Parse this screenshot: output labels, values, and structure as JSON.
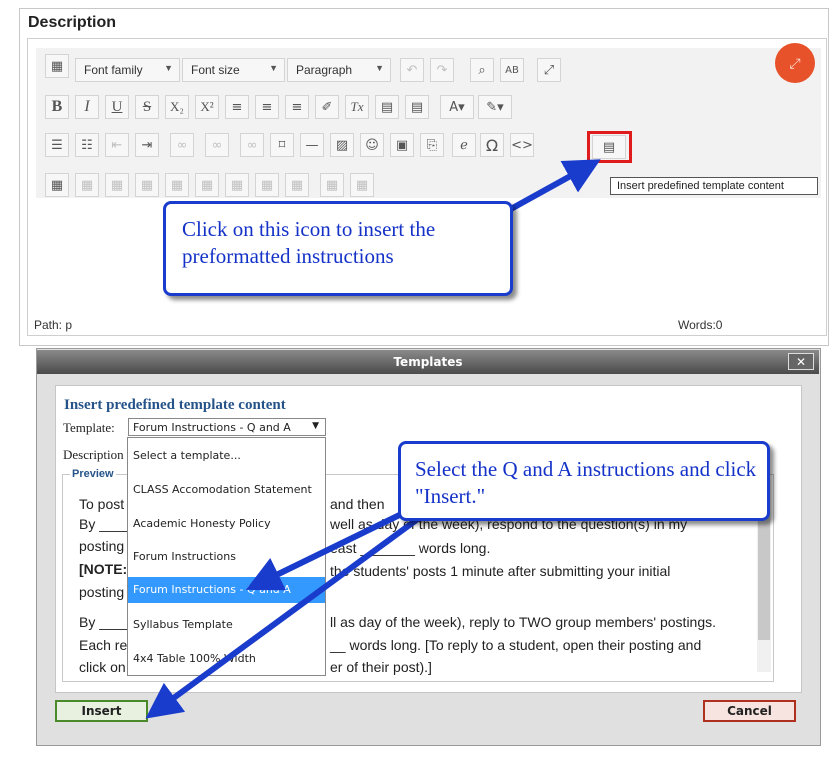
{
  "editor": {
    "section_title": "Description",
    "toolbar": {
      "font_family": "Font family",
      "font_size": "Font size",
      "paragraph": "Paragraph"
    },
    "status_path": "Path: p",
    "words": "Words:0",
    "tooltip": "Insert predefined template content"
  },
  "callouts": {
    "icon_hint": "Click on this icon to insert the preformatted instructions",
    "select_hint": "Select the Q and A instructions and click \"Insert.\""
  },
  "modal": {
    "title": "Templates",
    "close": "✕",
    "heading": "Insert predefined template content",
    "template_label": "Template:",
    "selected_template": "Forum Instructions - Q and A",
    "description_label": "Description",
    "preview_label": "Preview",
    "options": [
      "Select a template...",
      "CLASS Accomodation Statement",
      "Academic Honesty Policy",
      "Forum Instructions",
      "Forum Instructions - Q and A",
      "Syllabus Template",
      "4x4 Table 100% Width"
    ],
    "selected_index": 4,
    "preview_lines": {
      "l1a": "To post",
      "l1b": "and then",
      "l2a": "By ____",
      "l2b": "well as day of the week), respond to the question(s) in my",
      "l3a": "posting",
      "l3b": "east _______ words long.",
      "l4a": "[NOTE:",
      "l4b": "the students' posts 1 minute after submitting your initial",
      "l5a": "posting",
      "l6a": "By ____",
      "l6b": "ll as day of the week), reply to TWO group members' postings.",
      "l7a": "Each re",
      "l7b": "__ words long. [To reply to a student, open their posting and",
      "l8a": "click on",
      "l8b": "er of their post).]"
    },
    "insert_button": "Insert",
    "cancel_button": "Cancel"
  },
  "colors": {
    "callout_border": "#1a3ccc",
    "highlight": "#e01b1b",
    "fullscreen": "#e8522a",
    "selected_option": "#3399ff"
  }
}
